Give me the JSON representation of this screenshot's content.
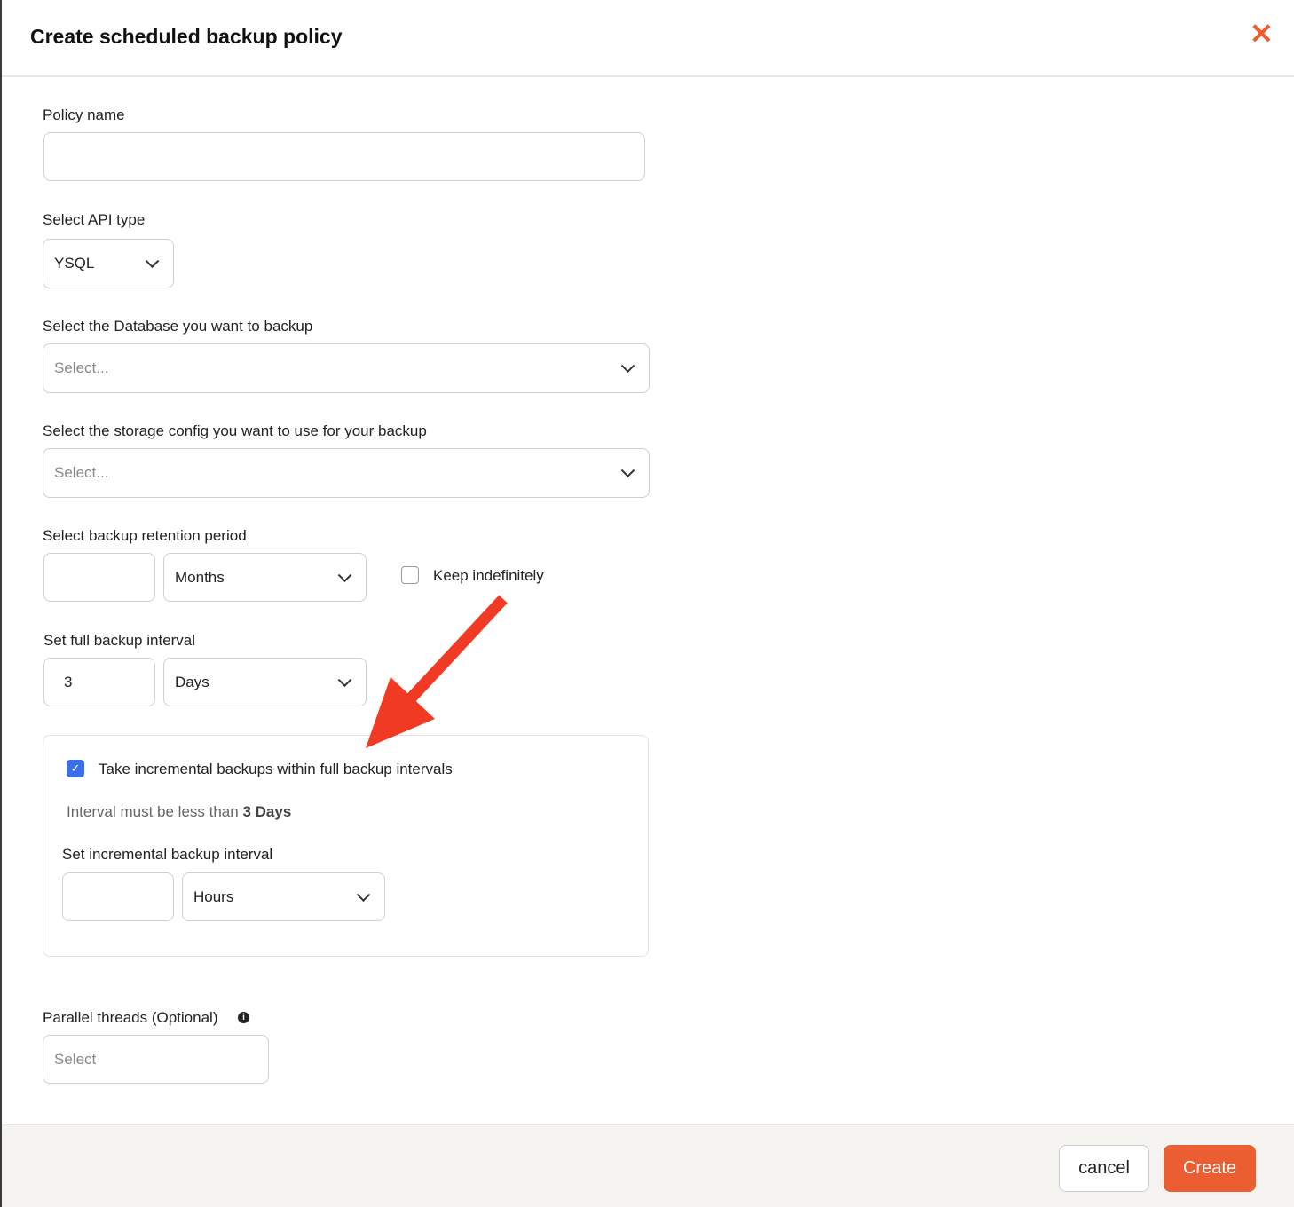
{
  "dialog": {
    "title": "Create scheduled backup policy",
    "close_icon": "close-icon"
  },
  "policy_name": {
    "label": "Policy name",
    "value": ""
  },
  "api_type": {
    "label": "Select API type",
    "value": "YSQL"
  },
  "database": {
    "label": "Select the Database you want to backup",
    "placeholder": "Select..."
  },
  "storage": {
    "label": "Select the storage config you want to use for your backup",
    "placeholder": "Select..."
  },
  "retention": {
    "label": "Select backup retention period",
    "value": "",
    "unit": "Months",
    "keep_label": "Keep indefinitely",
    "keep_checked": false
  },
  "full_interval": {
    "label": "Set full backup interval",
    "value": "3",
    "unit": "Days"
  },
  "incremental": {
    "checkbox_label": "Take incremental backups within full backup intervals",
    "checked": true,
    "hint_prefix": "Interval must be less than",
    "hint_bold": "3 Days",
    "label": "Set incremental backup interval",
    "value": "",
    "unit": "Hours"
  },
  "parallel": {
    "label": "Parallel threads (Optional)",
    "placeholder": "Select",
    "info_icon": "info-icon"
  },
  "footer": {
    "cancel": "cancel",
    "create": "Create"
  },
  "colors": {
    "accent": "#ef5b2f",
    "checkbox": "#3b6fe8",
    "annotation_arrow": "#f03a24"
  }
}
